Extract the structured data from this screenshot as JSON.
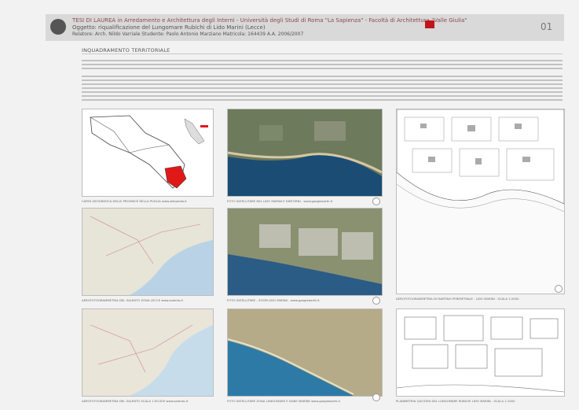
{
  "header": {
    "title_line1": "TESI DI LAUREA in Arredamento e Architettura degli Interni - Università degli Studi di Roma \"La Sapienza\" - Facoltà di Architettura \"Valle Giulia\"",
    "title_line2": "Oggetto: riqualificazione del Lungomare Rubichi di Lido Marini (Lecce)",
    "title_line3": "Relatore: Arch. Nildo Varriale  Studente: Paolo Antonio Marziano  Matricola: 164439  A.A. 2006/2007",
    "page_number": "01"
  },
  "section": {
    "title": "INQUADRAMENTO TERRITORIALE"
  },
  "captions": {
    "c1": "CARTA GEOGRAFICA DELLE PROVINCE DELLA PUGLIA www.wikipedia.it",
    "c2": "FOTO SATELLITARE DEL LIDO MARINI E DINTORNI - www.googleearth.it",
    "c3": "FOTO SATELLITARE - ZOOM LIDO MARINI - www.googleearth.it",
    "c4": "AEROFOTOGRAMMETRIA DI MARTINO PERIMETRALE - LIDO MARINI - SCALA 1:2000",
    "c5": "PLANIMETRIA QUOTATA DEL LUNGOMARE RUBICHI LIDO MARINI - SCALA 1:1000",
    "c6": "AEROFOTOGRAMMETRIA DEL SALENTO ZONA LECCE www.salento.it",
    "c7": "AEROFOTOGRAMMETRIA DEL SALENTO SCALA 1:50.000 www.salento.it",
    "c8": "FOTO SATELLITARE ZONA LUNGOMARE E DUNE MARINE www.googleearth.it"
  }
}
